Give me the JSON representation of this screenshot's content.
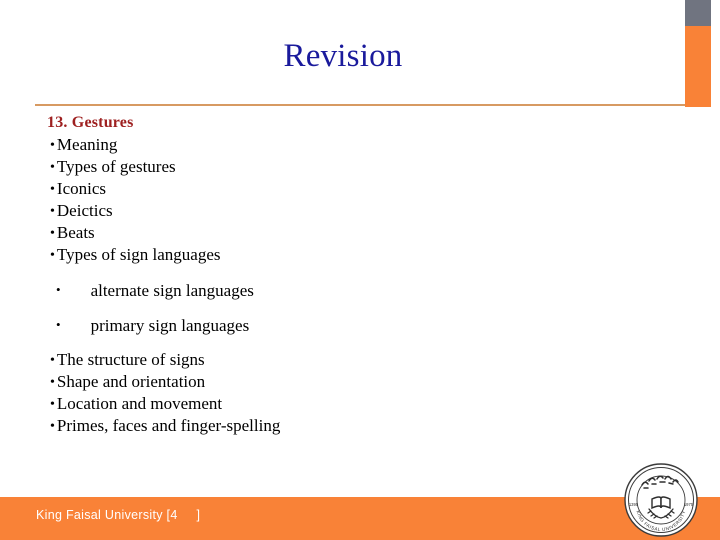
{
  "slide": {
    "title": "Revision",
    "title_color": "#1a1a9c",
    "rule_color": "#d79a62",
    "background": "#ffffff"
  },
  "decor": {
    "corner_gray_color": "#707480",
    "corner_orange_color": "#f98237"
  },
  "content": {
    "heading": "13. Gestures",
    "heading_color": "#9e2020",
    "items": [
      {
        "bullet": "•",
        "text": "Meaning",
        "level": 1
      },
      {
        "bullet": "•",
        "text": "Types of gestures",
        "level": 1
      },
      {
        "bullet": "•",
        "text": "Iconics",
        "level": 1
      },
      {
        "bullet": "•",
        "text": "Deictics",
        "level": 1
      },
      {
        "bullet": "•",
        "text": "Beats",
        "level": 1
      },
      {
        "bullet": "•",
        "text": "Types of sign languages",
        "level": 1
      },
      {
        "bullet": "•",
        "text": "alternate sign languages",
        "level": 2
      },
      {
        "bullet": "•",
        "text": "primary sign languages",
        "level": 2
      },
      {
        "bullet": "•",
        "text": "The structure of signs",
        "level": 1
      },
      {
        "bullet": "•",
        "text": "Shape and orientation",
        "level": 1
      },
      {
        "bullet": "•",
        "text": "Location and movement",
        "level": 1
      },
      {
        "bullet": "•",
        "text": "Primes, faces and finger-spelling",
        "level": 1
      }
    ]
  },
  "footer": {
    "text": "King Faisal University [4     ]",
    "bar_color": "#f98237",
    "text_color": "#ffffff"
  },
  "seal": {
    "name": "king-faisal-university-seal",
    "arabic_top": "جامعة الملك فيصل",
    "latin_bottom": "KING FAISAL UNIVERSITY",
    "year_left": "1395",
    "year_right": "1975"
  }
}
